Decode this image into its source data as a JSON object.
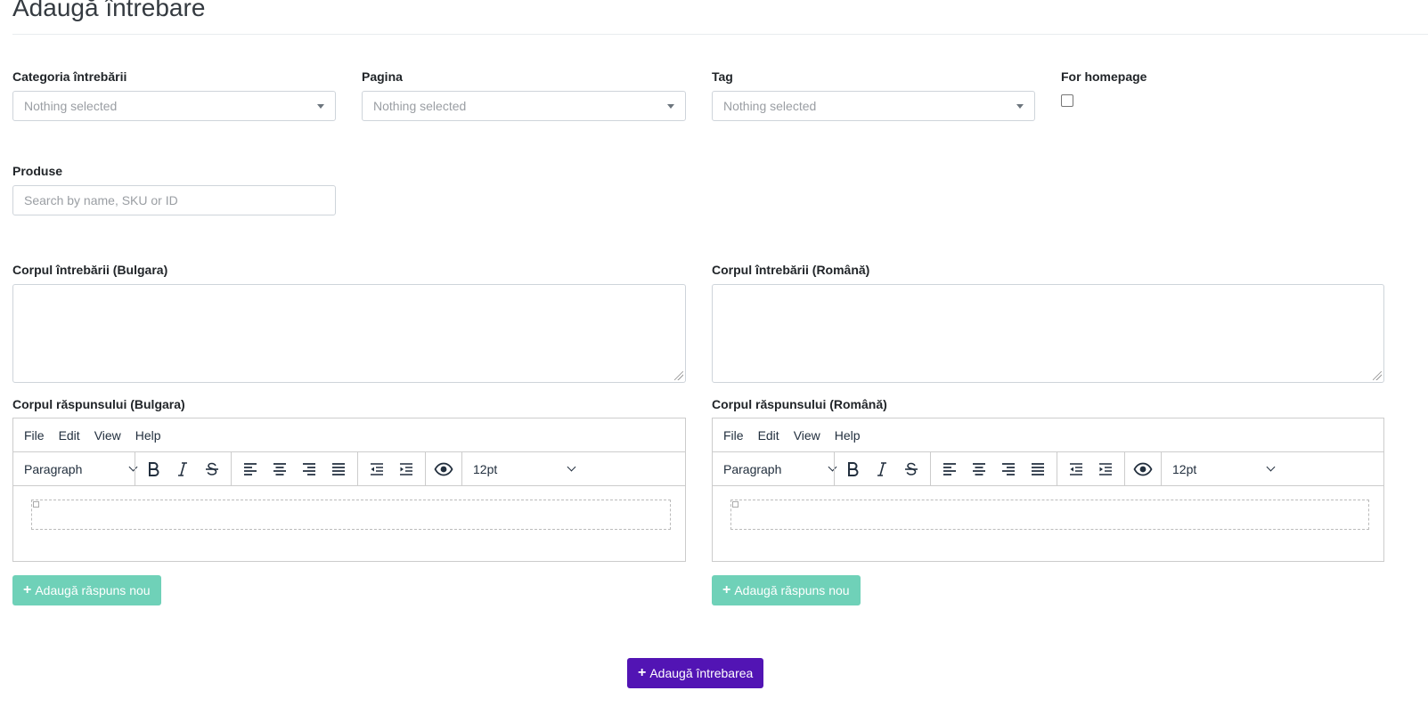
{
  "page": {
    "title": "Adaugă întrebare"
  },
  "fields": {
    "category": {
      "label": "Categoria întrebării",
      "value": "Nothing selected"
    },
    "page": {
      "label": "Pagina",
      "value": "Nothing selected"
    },
    "tag": {
      "label": "Tag",
      "value": "Nothing selected"
    },
    "homepage": {
      "label": "For homepage",
      "checked": false
    },
    "products": {
      "label": "Produse",
      "placeholder": "Search by name, SKU or ID"
    },
    "question_bg": {
      "label": "Corpul întrebării (Bulgara)"
    },
    "question_ro": {
      "label": "Corpul întrebării (Română)"
    }
  },
  "editors": {
    "answer_bg": {
      "label": "Corpul răspunsului (Bulgara)"
    },
    "answer_ro": {
      "label": "Corpul răspunsului (Română)"
    },
    "menu": {
      "file": "File",
      "edit": "Edit",
      "view": "View",
      "help": "Help"
    },
    "toolbar": {
      "block_format": "Paragraph",
      "font_size": "12pt"
    }
  },
  "buttons": {
    "plus_icon": "+",
    "add_answer": "Adaugă răspuns nou",
    "add_question": "Adaugă întrebarea"
  },
  "colors": {
    "green_button": "#6fd1b8",
    "purple_button": "#5214b4"
  }
}
